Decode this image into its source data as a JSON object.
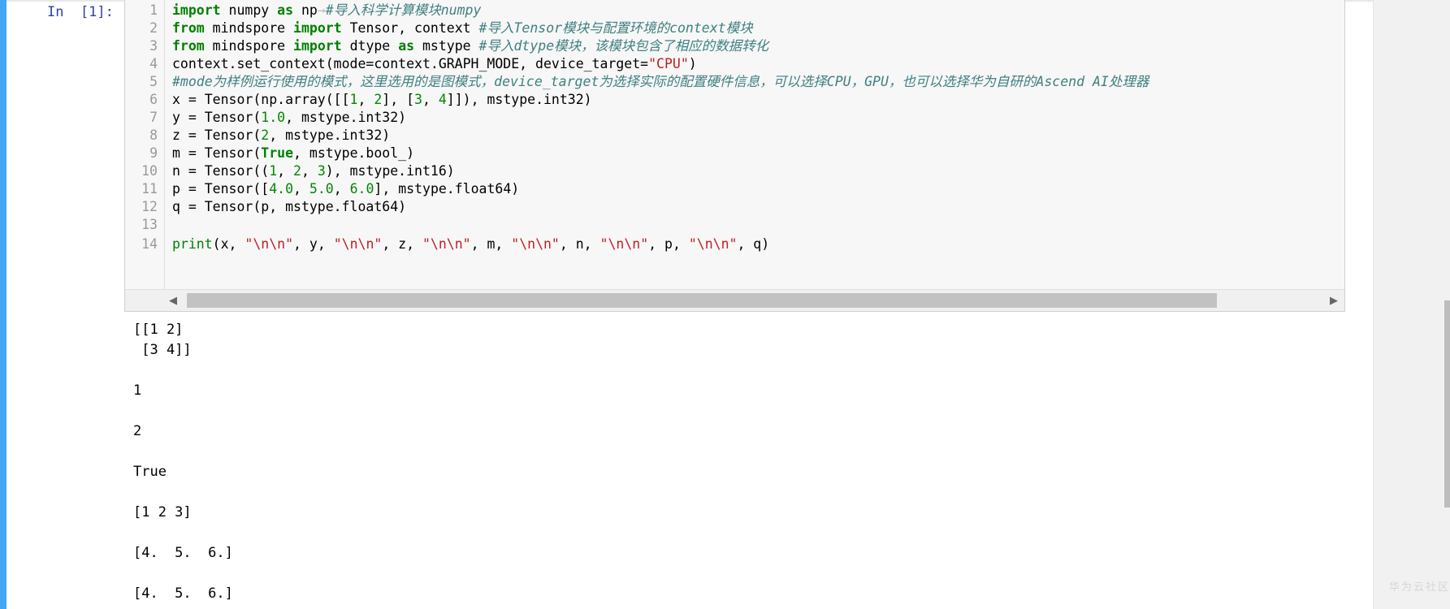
{
  "cell": {
    "prompt": "In  [1]:",
    "line_numbers": [
      "1",
      "2",
      "3",
      "4",
      "5",
      "6",
      "7",
      "8",
      "9",
      "10",
      "11",
      "12",
      "13",
      "14"
    ],
    "code": {
      "l1_kw1": "import",
      "l1_a": " numpy ",
      "l1_kw2": "as",
      "l1_b": " np",
      "l1_tab": "→",
      "l1_cm": "#导入科学计算模块numpy",
      "l2_kw1": "from",
      "l2_a": " mindspore ",
      "l2_kw2": "import",
      "l2_b": " Tensor, context ",
      "l2_cm": "#导入Tensor模块与配置环境的context模块",
      "l3_kw1": "from",
      "l3_a": " mindspore ",
      "l3_kw2": "import",
      "l3_b": " dtype ",
      "l3_kw3": "as",
      "l3_c": " mstype ",
      "l3_cm": "#导入dtype模块，该模块包含了相应的数据转化",
      "l4_a": "context.set_context(mode=context.GRAPH_MODE, device_target=",
      "l4_str": "\"CPU\"",
      "l4_b": ")",
      "l5_cm": "#mode为样例运行使用的模式，这里选用的是图模式，device_target为选择实际的配置硬件信息，可以选择CPU，GPU，也可以选择华为自研的Ascend AI处理器",
      "l6_a": "x = Tensor(np.array([[",
      "l6_n1": "1",
      "l6_b": ", ",
      "l6_n2": "2",
      "l6_c": "], [",
      "l6_n3": "3",
      "l6_d": ", ",
      "l6_n4": "4",
      "l6_e": "]]), mstype.int32)",
      "l7_a": "y = Tensor(",
      "l7_n": "1.0",
      "l7_b": ", mstype.int32)",
      "l8_a": "z = Tensor(",
      "l8_n": "2",
      "l8_b": ", mstype.int32)",
      "l9_a": "m = Tensor(",
      "l9_kw": "True",
      "l9_b": ", mstype.bool_)",
      "l10_a": "n = Tensor((",
      "l10_n1": "1",
      "l10_b": ", ",
      "l10_n2": "2",
      "l10_c": ", ",
      "l10_n3": "3",
      "l10_d": "), mstype.int16)",
      "l11_a": "p = Tensor([",
      "l11_n1": "4.0",
      "l11_b": ", ",
      "l11_n2": "5.0",
      "l11_c": ", ",
      "l11_n3": "6.0",
      "l11_d": "], mstype.float64)",
      "l12_a": "q = Tensor(p, mstype.float64)",
      "l14_bi": "print",
      "l14_a": "(x, ",
      "l14_s": "\"\\n\\n\"",
      "l14_b": ", y, ",
      "l14_c": ", z, ",
      "l14_d": ", m, ",
      "l14_e": ", n, ",
      "l14_f": ", p, ",
      "l14_g": ", q)"
    }
  },
  "output": {
    "lines": [
      "[[1 2]",
      " [3 4]]",
      "1",
      "2",
      "True",
      "[1 2 3]",
      "[4.  5.  6.]",
      "[4.  5.  6.]"
    ]
  },
  "scroll": {
    "left_arrow": "◀",
    "right_arrow": "▶"
  },
  "watermark": "华为云社区",
  "colors": {
    "accent": "#42a5f5",
    "keyword": "#008000",
    "comment": "#408080",
    "string": "#ba2121"
  }
}
